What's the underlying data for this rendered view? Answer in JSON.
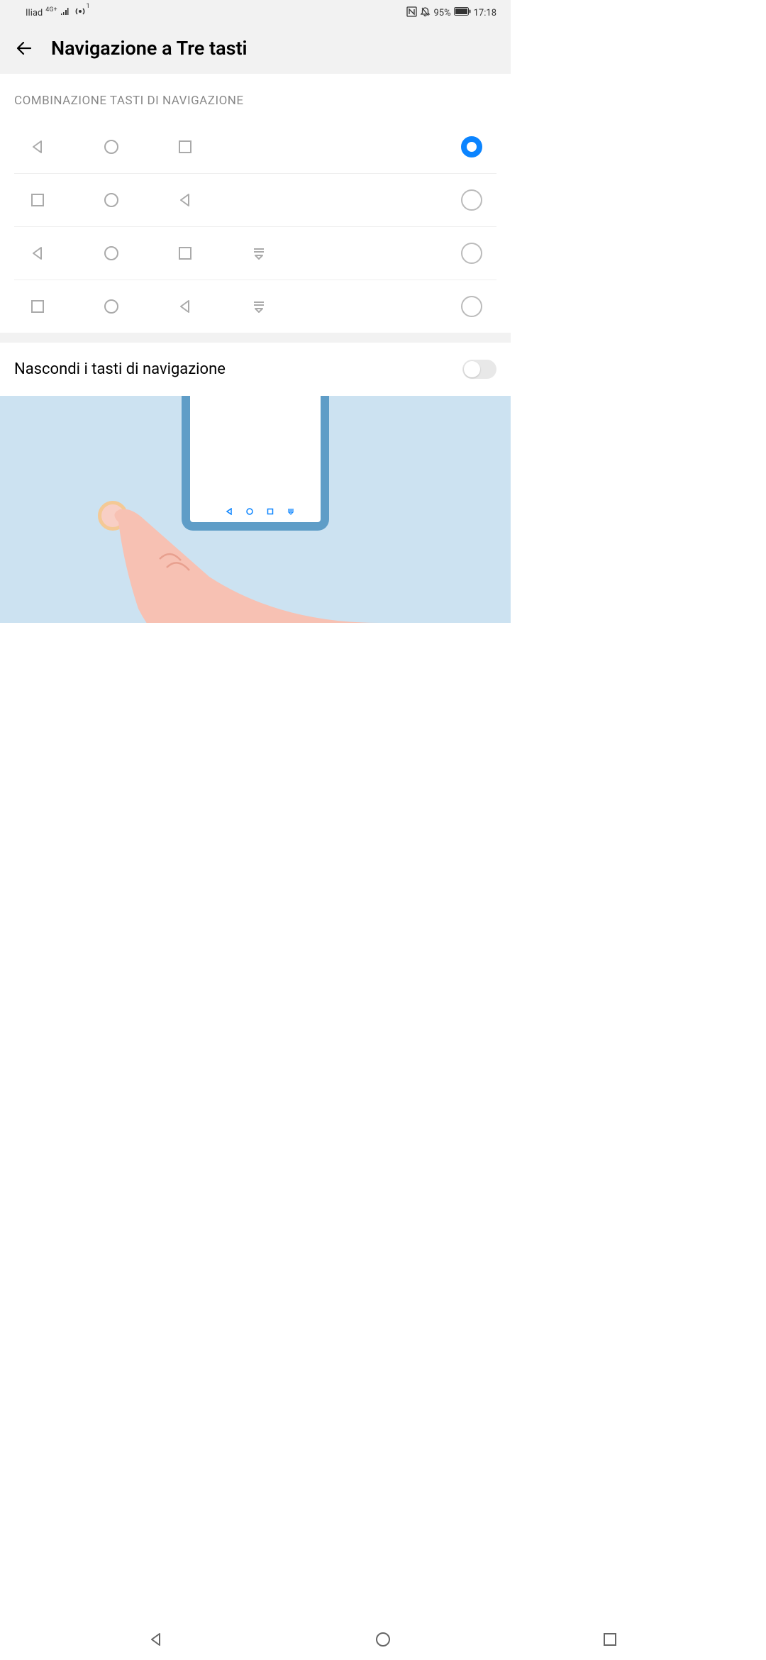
{
  "status": {
    "carrier": "Iliad",
    "network": "4G+",
    "hotspot_badge": "1",
    "battery_pct": "95%",
    "time": "17:18"
  },
  "header": {
    "title": "Navigazione a Tre tasti"
  },
  "section_label": "COMBINAZIONE TASTI DI NAVIGAZIONE",
  "options": [
    {
      "icons": [
        "back",
        "home",
        "recent"
      ],
      "selected": true
    },
    {
      "icons": [
        "recent",
        "home",
        "back"
      ],
      "selected": false
    },
    {
      "icons": [
        "back",
        "home",
        "recent",
        "notif"
      ],
      "selected": false
    },
    {
      "icons": [
        "recent",
        "home",
        "back",
        "notif"
      ],
      "selected": false
    }
  ],
  "toggle": {
    "label": "Nascondi i tasti di navigazione",
    "value": false
  }
}
